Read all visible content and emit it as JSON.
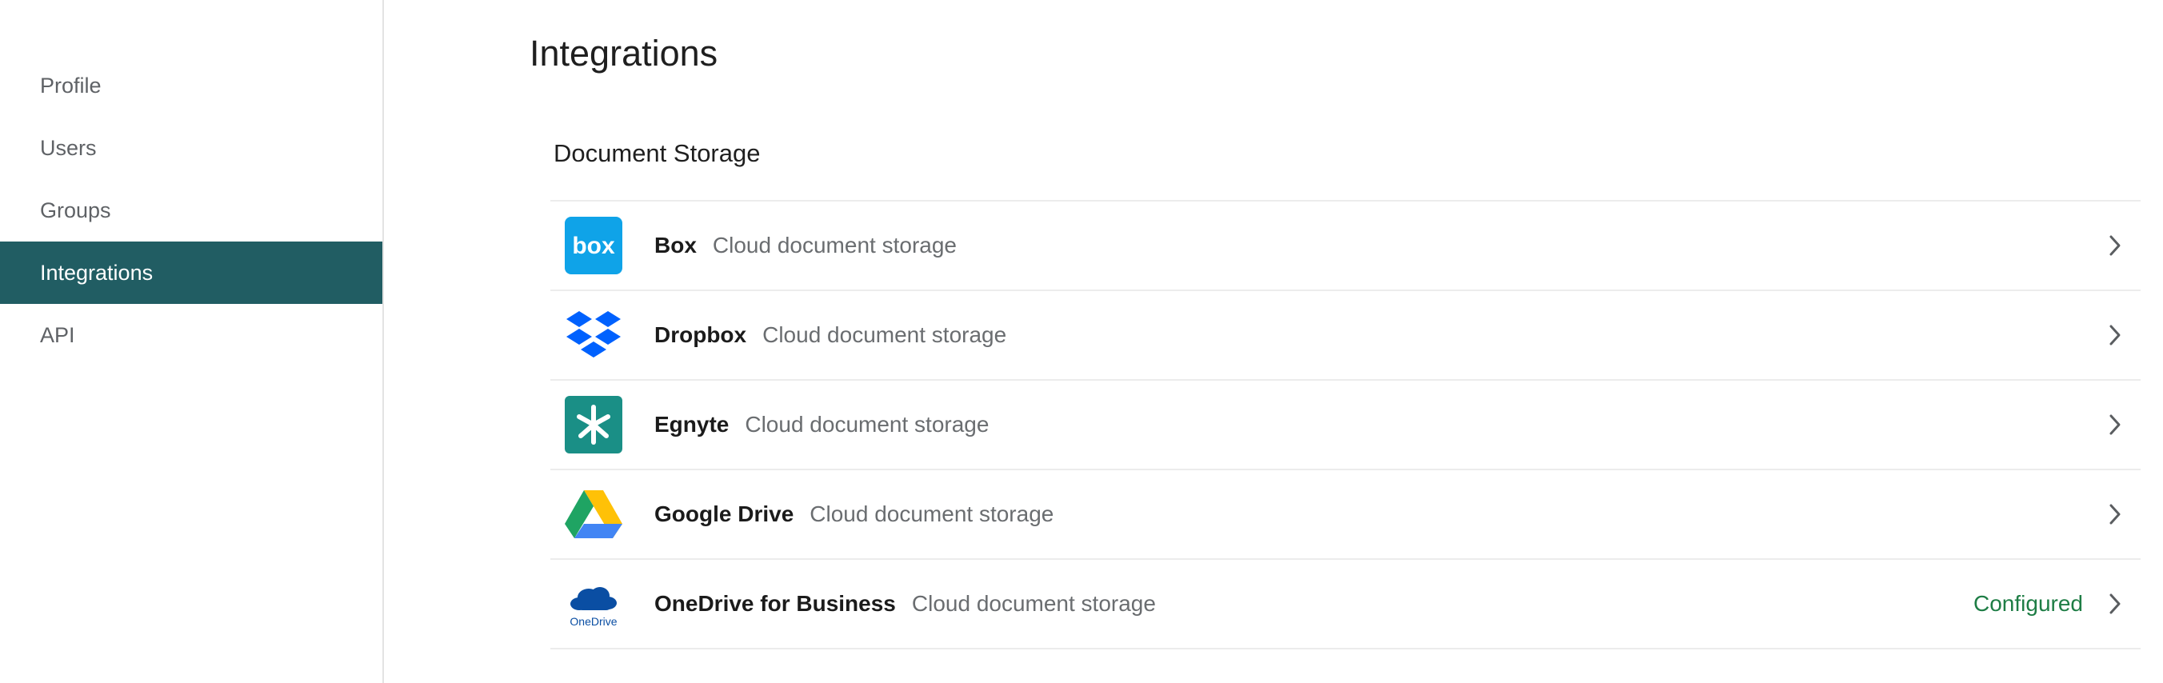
{
  "sidebar": {
    "items": [
      {
        "label": "Profile",
        "active": false
      },
      {
        "label": "Users",
        "active": false
      },
      {
        "label": "Groups",
        "active": false
      },
      {
        "label": "Integrations",
        "active": true
      },
      {
        "label": "API",
        "active": false
      }
    ],
    "active_color": "#215d63"
  },
  "main": {
    "title": "Integrations",
    "section_title": "Document Storage",
    "integrations": [
      {
        "name": "Box",
        "description": "Cloud document storage",
        "status": "",
        "icon": "box-logo-icon",
        "brand_color": "#0fa3e8"
      },
      {
        "name": "Dropbox",
        "description": "Cloud document storage",
        "status": "",
        "icon": "dropbox-logo-icon",
        "brand_color": "#0061fe"
      },
      {
        "name": "Egnyte",
        "description": "Cloud document storage",
        "status": "",
        "icon": "egnyte-logo-icon",
        "brand_color": "#1a8f86"
      },
      {
        "name": "Google Drive",
        "description": "Cloud document storage",
        "status": "",
        "icon": "google-drive-logo-icon",
        "brand_color": "#1fa463"
      },
      {
        "name": "OneDrive for Business",
        "description": "Cloud document storage",
        "status": "Configured",
        "icon": "onedrive-logo-icon",
        "brand_color": "#0a4ea3",
        "logo_text": "OneDrive"
      }
    ],
    "status_color": "#1e7d45"
  },
  "logos": {
    "box_text": "box"
  }
}
